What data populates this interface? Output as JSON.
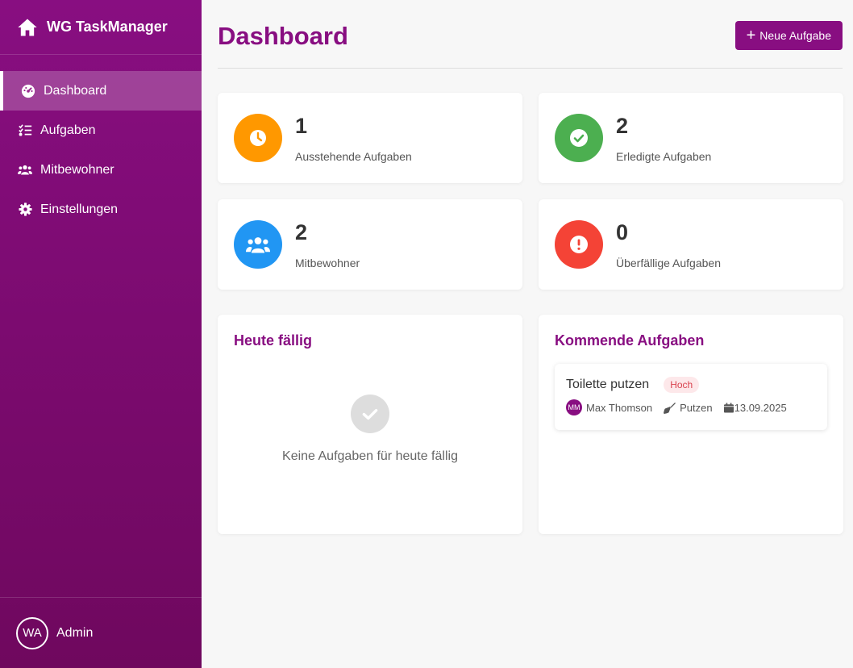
{
  "app": {
    "title": "WG TaskManager"
  },
  "sidebar": {
    "items": [
      {
        "label": "Dashboard",
        "icon": "dashboard-gauge-icon",
        "active": true
      },
      {
        "label": "Aufgaben",
        "icon": "tasks-list-icon",
        "active": false
      },
      {
        "label": "Mitbewohner",
        "icon": "users-icon",
        "active": false
      },
      {
        "label": "Einstellungen",
        "icon": "gear-icon",
        "active": false
      }
    ],
    "user": {
      "initials": "WA",
      "name": "Admin"
    }
  },
  "header": {
    "title": "Dashboard",
    "new_task_label": "Neue Aufgabe"
  },
  "stats": [
    {
      "value": "1",
      "label": "Ausstehende Aufgaben",
      "color": "#ff9800",
      "icon": "clock-icon"
    },
    {
      "value": "2",
      "label": "Erledigte Aufgaben",
      "color": "#4caf50",
      "icon": "check-circle-icon"
    },
    {
      "value": "2",
      "label": "Mitbewohner",
      "color": "#2196f3",
      "icon": "users-icon"
    },
    {
      "value": "0",
      "label": "Überfällige Aufgaben",
      "color": "#f44336",
      "icon": "exclamation-icon"
    }
  ],
  "today": {
    "title": "Heute fällig",
    "empty_text": "Keine Aufgaben für heute fällig"
  },
  "upcoming": {
    "title": "Kommende Aufgaben",
    "tasks": [
      {
        "title": "Toilette putzen",
        "priority": "Hoch",
        "assignee_initials": "MM",
        "assignee": "Max Thomson",
        "category": "Putzen",
        "date": "13.09.2025"
      }
    ]
  },
  "colors": {
    "brand": "#880e81",
    "priority_high": "#d9434f"
  }
}
